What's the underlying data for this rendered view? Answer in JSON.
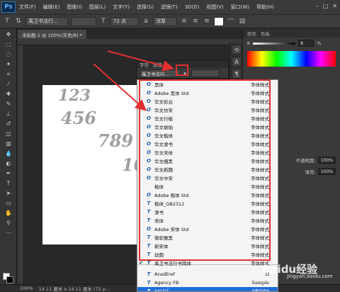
{
  "menubar": {
    "logo": "Ps",
    "items": [
      "文件(F)",
      "编辑(E)",
      "图像(I)",
      "图层(L)",
      "文字(Y)",
      "选择(S)",
      "滤镜(T)",
      "3D(D)",
      "视图(V)",
      "窗口(W)",
      "帮助(H)"
    ]
  },
  "options": {
    "font_family": "禹卫书法行...",
    "font_size": "72 点",
    "antialias": "浑厚"
  },
  "document": {
    "tab_title": "未标题-1 @ 100%(灰色/8) *",
    "handwriting": [
      "123",
      "456",
      "789",
      "10"
    ]
  },
  "status": {
    "zoom": "100%",
    "doc_size": "14.11 厘米 x 14.11 厘米 (72 p..."
  },
  "right_panel": {
    "tabs": [
      "颜色",
      "色板"
    ],
    "k_label": "K",
    "k_value": "8",
    "k_unit": "%",
    "opacity_label": "不透明度:",
    "opacity_value": "100%",
    "fill_label": "填充:",
    "fill_value": "100%"
  },
  "char_panel": {
    "tabs": [
      "字符",
      "段落"
    ],
    "font_value": "禹卫书法行..."
  },
  "font_list": [
    {
      "icon": "O",
      "name": "黑体",
      "sample": "字体样式"
    },
    {
      "icon": "O",
      "name": "Adobe 黑体 Std",
      "sample": "字体样式"
    },
    {
      "icon": "O",
      "name": "华文彩云",
      "sample": "字体样式"
    },
    {
      "icon": "O",
      "name": "华文仿宋",
      "sample": "字体样式"
    },
    {
      "icon": "O",
      "name": "华文行楷",
      "sample": "字体样式"
    },
    {
      "icon": "O",
      "name": "华文琥珀",
      "sample": "字体样式"
    },
    {
      "icon": "O",
      "name": "华文楷体",
      "sample": "字体样式"
    },
    {
      "icon": "O",
      "name": "华文隶书",
      "sample": "字体样式"
    },
    {
      "icon": "O",
      "name": "华文宋体",
      "sample": "字体样式"
    },
    {
      "icon": "O",
      "name": "华文细黑",
      "sample": "字体样式"
    },
    {
      "icon": "O",
      "name": "华文新魏",
      "sample": "字体样式"
    },
    {
      "icon": "O",
      "name": "华文中宋",
      "sample": "字体样式"
    },
    {
      "icon": "",
      "name": "楷体",
      "sample": "字体样式"
    },
    {
      "icon": "O",
      "name": "Adobe 楷体 Std",
      "sample": "字体样式"
    },
    {
      "icon": "T",
      "name": "楷体_GB2312",
      "sample": "字体样式"
    },
    {
      "icon": "T",
      "name": "隶书",
      "sample": "字体样式"
    },
    {
      "icon": "T",
      "name": "宋体",
      "sample": "字体样式"
    },
    {
      "icon": "O",
      "name": "Adobe 宋体 Std",
      "sample": "字体样式"
    },
    {
      "icon": "T",
      "name": "微软雅黑",
      "sample": "字体样式"
    },
    {
      "icon": "T",
      "name": "新宋体",
      "sample": "字体样式"
    },
    {
      "icon": "T",
      "name": "幼圆",
      "sample": "字体样式"
    },
    {
      "icon": "T",
      "name": "禹卫书法行书简体",
      "sample": "字体样式",
      "checked": true
    },
    {
      "icon": "T",
      "name": "AcadEref",
      "sample": "Ω"
    },
    {
      "icon": "T",
      "name": "Agency FB",
      "sample": "Sample"
    },
    {
      "icon": "T",
      "name": "AIGDT",
      "sample": "⌀⊕◎⊘⌖",
      "selected": true
    }
  ],
  "watermark": {
    "text": "Baidu经验",
    "sub": "jingyan.baidu.com"
  }
}
